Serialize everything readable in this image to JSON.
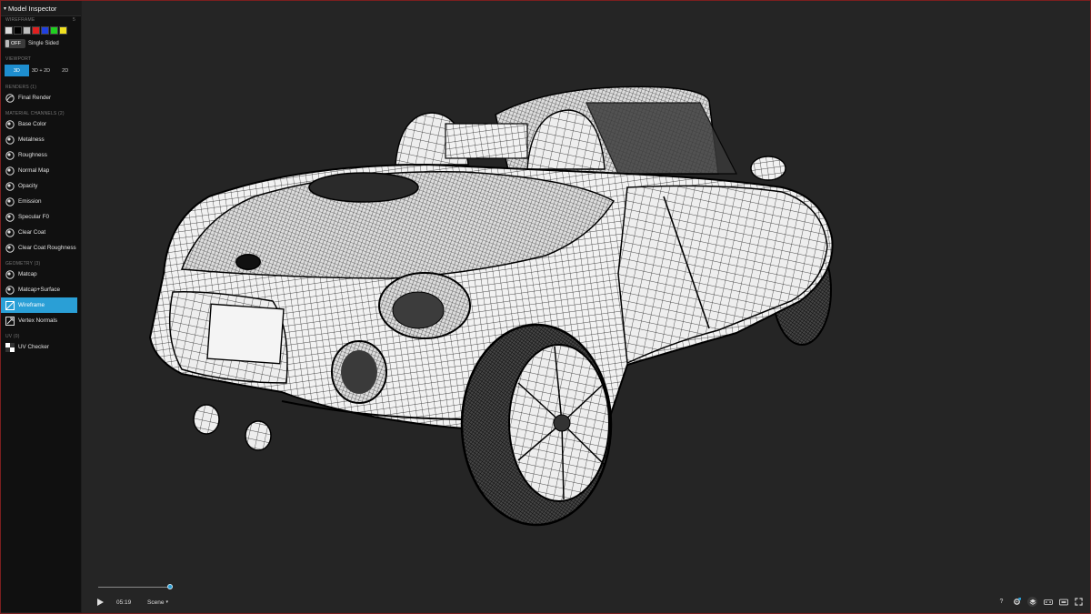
{
  "panel": {
    "title": "Model Inspector",
    "sections": {
      "wireframe": "Wireframe",
      "wireframe_count": "5",
      "viewport": "Viewport",
      "renders": "Renders (1)",
      "material": "Material channels (2)",
      "geometry": "Geometry (3)",
      "uv": "UV (0)"
    },
    "swatches": [
      "#dcdcdc",
      "#000000",
      "#bdbdbd",
      "#e02020",
      "#2040e0",
      "#20d020",
      "#f0e020"
    ],
    "single_sided": {
      "state": "OFF",
      "label": "Single Sided"
    },
    "viewport_buttons": [
      "3D",
      "3D + 2D",
      "2D"
    ],
    "render_items": [
      {
        "label": "Final Render",
        "icon": "final-render-icon"
      }
    ],
    "material_items": [
      {
        "label": "Base Color",
        "icon": "base-color-icon"
      },
      {
        "label": "Metalness",
        "icon": "metalness-icon"
      },
      {
        "label": "Roughness",
        "icon": "roughness-icon"
      },
      {
        "label": "Normal Map",
        "icon": "normal-map-icon"
      },
      {
        "label": "Opacity",
        "icon": "opacity-icon"
      },
      {
        "label": "Emission",
        "icon": "emission-icon"
      },
      {
        "label": "Specular F0",
        "icon": "specular-icon"
      },
      {
        "label": "Clear Coat",
        "icon": "clear-coat-icon"
      },
      {
        "label": "Clear Coat Roughness",
        "icon": "clear-coat-roughness-icon"
      }
    ],
    "geometry_items": [
      {
        "label": "Matcap",
        "icon": "matcap-icon"
      },
      {
        "label": "Matcap+Surface",
        "icon": "matcap-surface-icon"
      },
      {
        "label": "Wireframe",
        "icon": "wireframe-icon",
        "active": true
      },
      {
        "label": "Vertex Normals",
        "icon": "vertex-normals-icon"
      }
    ],
    "uv_items": [
      {
        "label": "UV Checker",
        "icon": "uv-checker-icon"
      }
    ]
  },
  "player": {
    "time": "05:19",
    "scene_label": "Scene",
    "progress": 0.97
  },
  "toolbar_icons": [
    "help-icon",
    "settings-icon",
    "layers-icon",
    "vr-icon",
    "cardboard-icon",
    "fullscreen-icon"
  ],
  "toolbar_labels": {
    "help": "?"
  },
  "colors": {
    "accent": "#2a9fd6",
    "background": "#252525",
    "sidebar": "#101010"
  }
}
